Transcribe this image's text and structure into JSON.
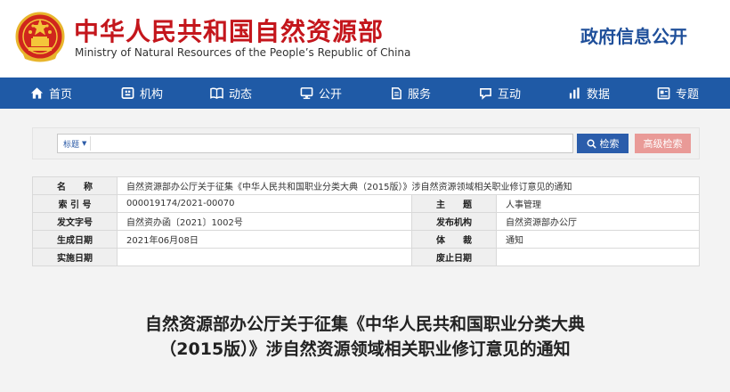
{
  "header": {
    "title_cn": "中华人民共和国自然资源部",
    "title_en": "Ministry of Natural Resources of the People’s Republic of China",
    "gov_info": "政府信息公开"
  },
  "nav": [
    {
      "label": "首页",
      "icon": "home-icon"
    },
    {
      "label": "机构",
      "icon": "organization-icon"
    },
    {
      "label": "动态",
      "icon": "book-icon"
    },
    {
      "label": "公开",
      "icon": "monitor-icon"
    },
    {
      "label": "服务",
      "icon": "service-icon"
    },
    {
      "label": "互动",
      "icon": "chat-icon"
    },
    {
      "label": "数据",
      "icon": "bar-chart-icon"
    },
    {
      "label": "专题",
      "icon": "topic-icon"
    }
  ],
  "search": {
    "scope": "标题",
    "placeholder": "",
    "search_label": "检索",
    "advanced_label": "高级检索"
  },
  "meta": {
    "name_label": "名　　称",
    "name_value": "自然资源部办公厅关于征集《中华人民共和国职业分类大典（2015版）》涉自然资源领域相关职业修订意见的通知",
    "index_label": "索 引 号",
    "index_value": "000019174/2021-00070",
    "topic_label": "主　　题",
    "topic_value": "人事管理",
    "docno_label": "发文字号",
    "docno_value": "自然资办函〔2021〕1002号",
    "issuer_label": "发布机构",
    "issuer_value": "自然资源部办公厅",
    "date_label": "生成日期",
    "date_value": "2021年06月08日",
    "genre_label": "体　　裁",
    "genre_value": "通知",
    "effective_label": "实施日期",
    "effective_value": "",
    "repeal_label": "废止日期",
    "repeal_value": ""
  },
  "article": {
    "title": "自然资源部办公厅关于征集《中华人民共和国职业分类大典（2015版）》涉自然资源领域相关职业修订意见的通知"
  },
  "colors": {
    "brand_red": "#c4161c",
    "nav_blue": "#1f5aa6",
    "search_blue": "#2b5dab",
    "advanced_pink": "#e99a97"
  }
}
